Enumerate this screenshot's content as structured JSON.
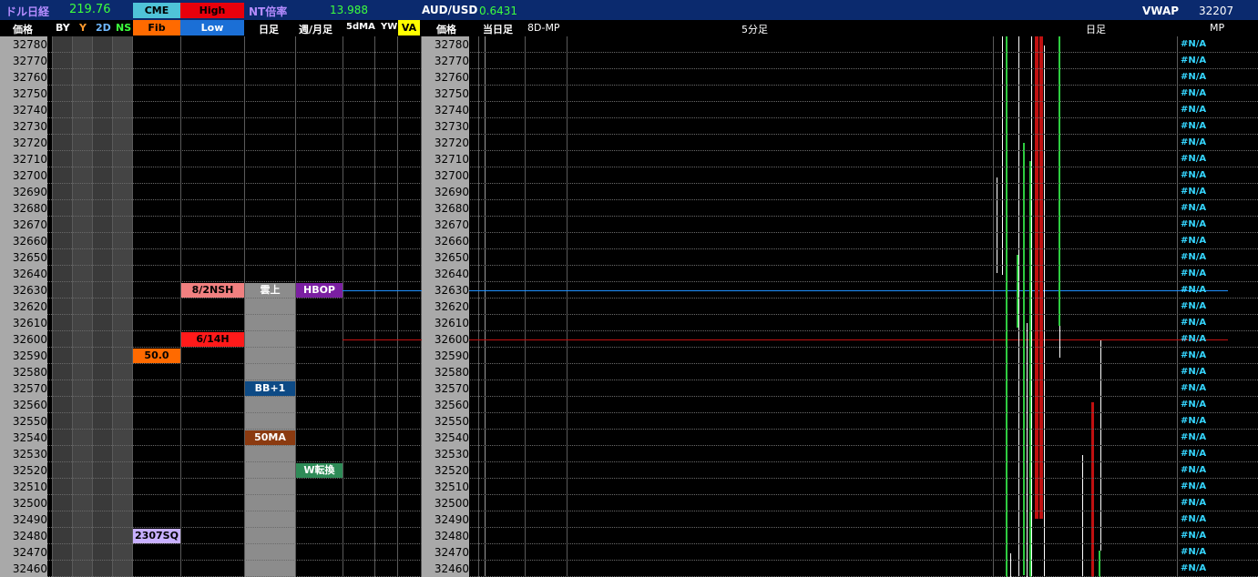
{
  "top": {
    "dollar_nikkei_label": "ドル日経",
    "dollar_nikkei_value": "219.76",
    "cme_label": "CME",
    "high_label": "High",
    "nt_label": "NT倍率",
    "nt_value": "13.988",
    "audusd_label": "AUD/USD",
    "audusd_value": "0.6431",
    "vwap_label": "VWAP",
    "vwap_value": "32207"
  },
  "header": {
    "price": "価格",
    "by": "BY",
    "y": "Y",
    "two_d": "2D",
    "ns": "NS",
    "fib": "Fib",
    "low": "Low",
    "daily": "日足",
    "weekly_monthly": "週/月足",
    "five_dma": "5dMA",
    "yw": "YW",
    "va": "VA",
    "price2": "価格",
    "today": "当日足",
    "eight_d_mp": "8D-MP",
    "five_min": "5分足",
    "daily2": "日足",
    "mp": "MP"
  },
  "prices": [
    "32780",
    "32770",
    "32760",
    "32750",
    "32740",
    "32730",
    "32720",
    "32710",
    "32700",
    "32690",
    "32680",
    "32670",
    "32660",
    "32650",
    "32640",
    "32630",
    "32620",
    "32610",
    "32600",
    "32590",
    "32580",
    "32570",
    "32560",
    "32550",
    "32540",
    "32530",
    "32520",
    "32510",
    "32500",
    "32490",
    "32480",
    "32470",
    "32460"
  ],
  "mp_value": "#N/A",
  "tags": {
    "nsh": "8/2NSH",
    "h14": "6/14H",
    "fib50": "50.0",
    "sq": "2307SQ",
    "kumo": "雲上",
    "hbop": "HBOP",
    "bb": "BB+1",
    "ma50": "50MA",
    "wturn": "W転換"
  },
  "colors": {
    "top_bg": "#0b2a6e",
    "cme_bg": "#4fc3d8",
    "high_bg": "#e8000c",
    "fib_bg": "#ff6a00",
    "low_bg": "#1b6fd6",
    "va_bg": "#ffff00",
    "price_bg": "#a9a9a9",
    "mp_text": "#35d6ff",
    "blue_line": "#1e90ff",
    "red_line": "#c01010"
  }
}
